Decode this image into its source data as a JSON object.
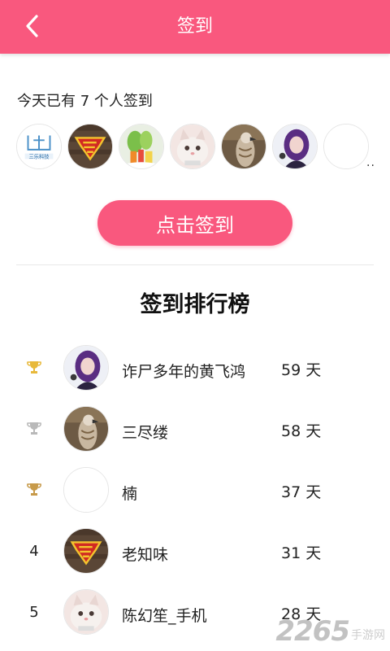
{
  "header": {
    "title": "签到",
    "back_icon": "back-icon"
  },
  "today": {
    "text": "今天已有 7 个人签到"
  },
  "recent_avatars": [
    {
      "name": "avatar-sanle",
      "label": "三乐科技"
    },
    {
      "name": "avatar-superman"
    },
    {
      "name": "avatar-vegetables"
    },
    {
      "name": "avatar-cat"
    },
    {
      "name": "avatar-eagle"
    },
    {
      "name": "avatar-purple-girl"
    },
    {
      "name": "avatar-empty"
    }
  ],
  "more": "..",
  "checkin_button": "点击签到",
  "ranking": {
    "title": "签到排行榜",
    "rows": [
      {
        "rank": "1",
        "medal": "gold",
        "name": "诈尸多年的黄飞鸿",
        "days": "59 天",
        "avatar": "purple-girl"
      },
      {
        "rank": "2",
        "medal": "silver",
        "name": "三尽缕",
        "days": "58 天",
        "avatar": "eagle"
      },
      {
        "rank": "3",
        "medal": "bronze",
        "name": "楠",
        "days": "37 天",
        "avatar": "empty"
      },
      {
        "rank": "4",
        "medal": "",
        "name": "老知味",
        "days": "31 天",
        "avatar": "superman"
      },
      {
        "rank": "5",
        "medal": "",
        "name": "陈幻笙_手机",
        "days": "28 天",
        "avatar": "cat"
      }
    ]
  },
  "colors": {
    "accent": "#f9587e",
    "gold": "#e8b93a",
    "silver": "#b9b9b9",
    "bronze": "#c79a4a"
  },
  "watermark": {
    "big": "2265",
    "small": "手游网"
  }
}
